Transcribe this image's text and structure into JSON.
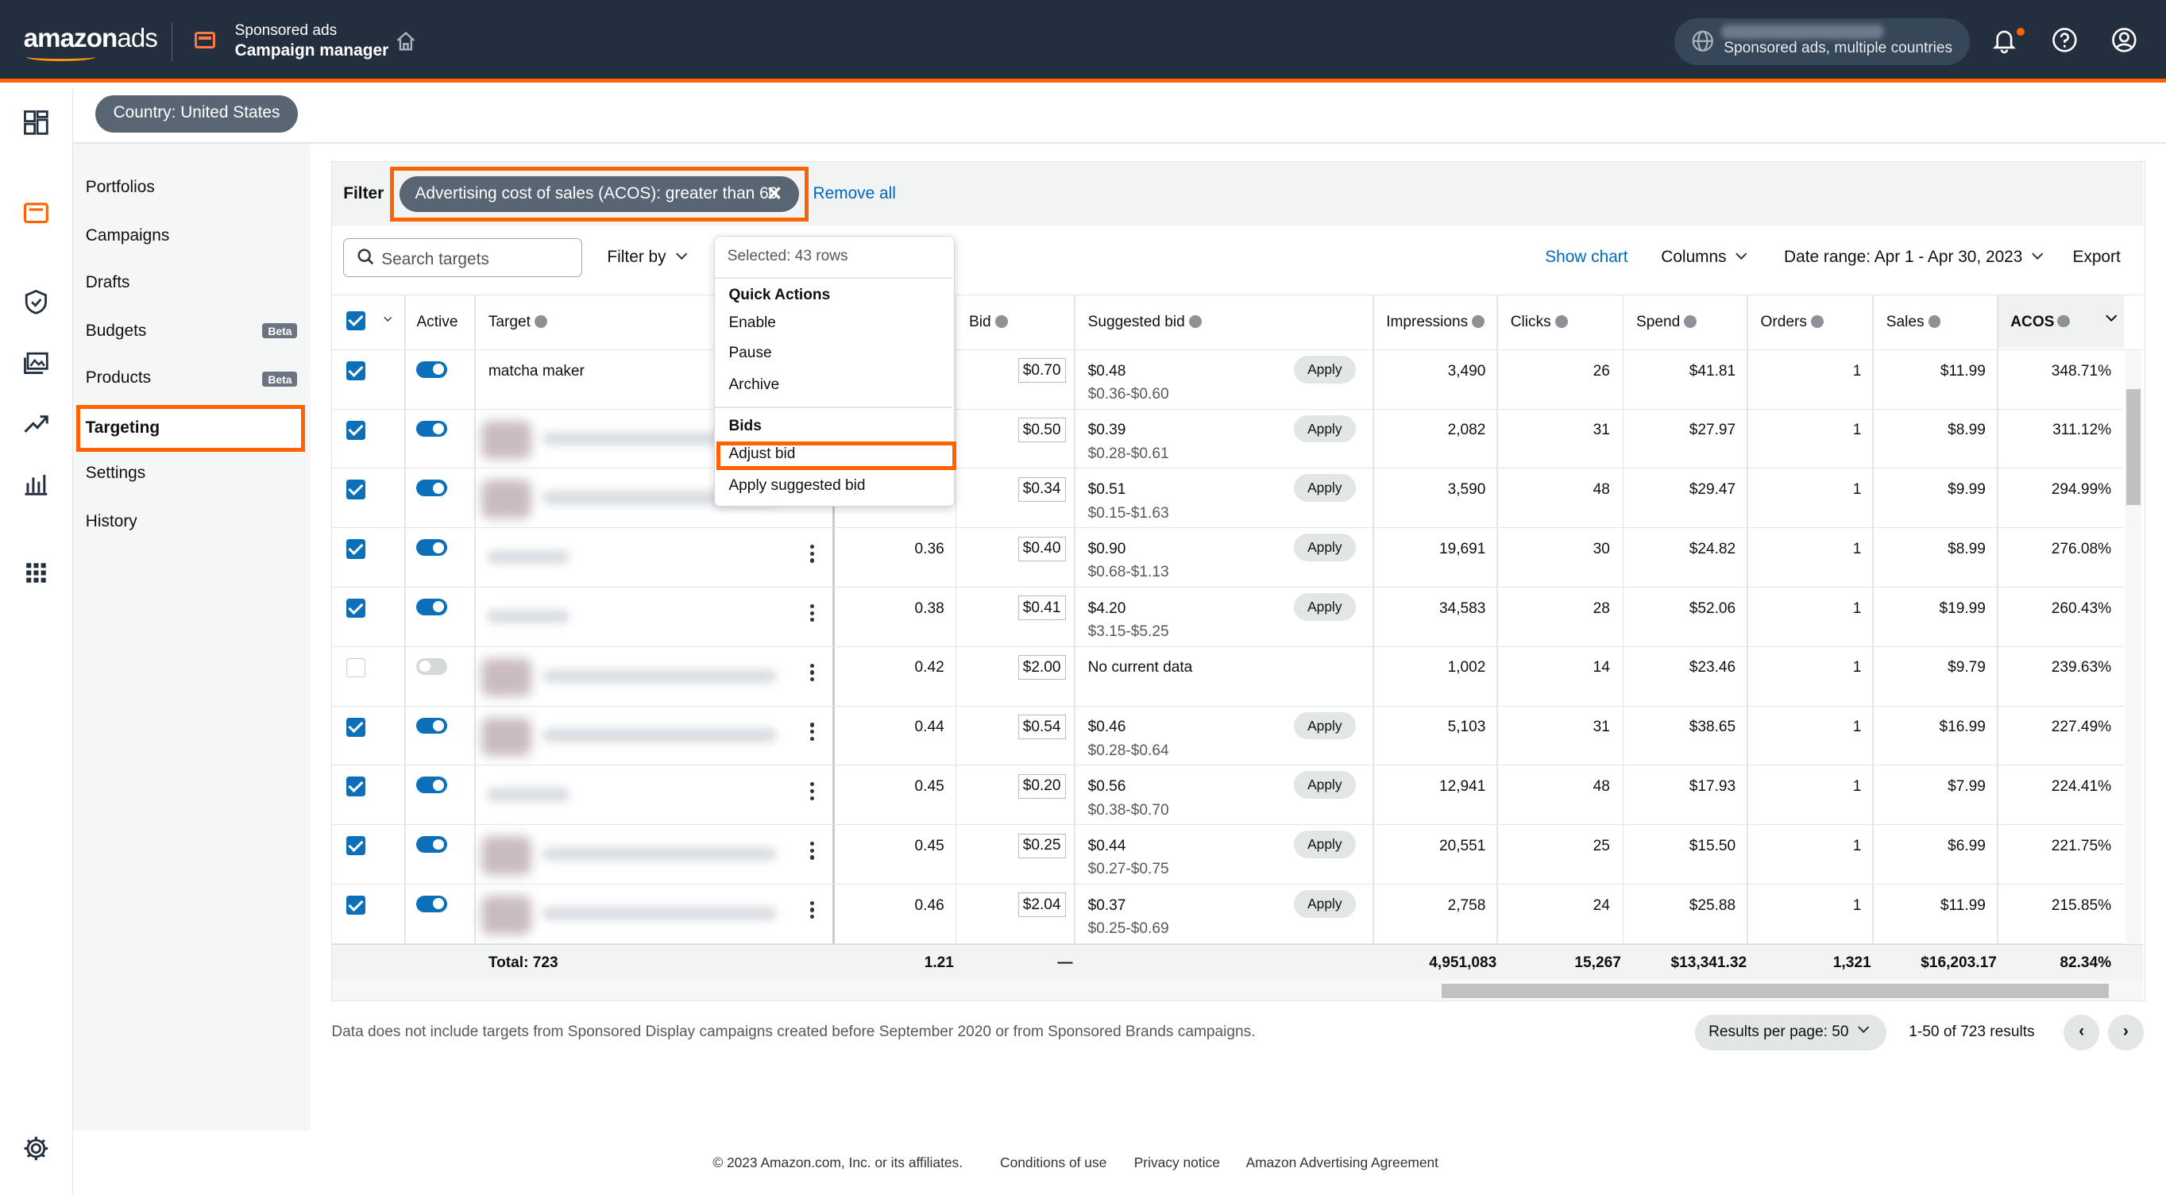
{
  "topbar": {
    "logo_text": "amazon",
    "logo_suffix": "ads",
    "product_line1": "Sponsored ads",
    "product_line2": "Campaign manager",
    "account_label": "Sponsored ads, multiple countries"
  },
  "country_pill": "Country: United States",
  "sidenav": {
    "items": [
      {
        "label": "Portfolios"
      },
      {
        "label": "Campaigns"
      },
      {
        "label": "Drafts"
      },
      {
        "label": "Budgets",
        "badge": "Beta"
      },
      {
        "label": "Products",
        "badge": "Beta"
      },
      {
        "label": "Targeting",
        "active": true
      },
      {
        "label": "Settings"
      },
      {
        "label": "History"
      }
    ]
  },
  "filterbar": {
    "label": "Filter",
    "chip": "Advertising cost of sales (ACOS): greater than 60",
    "chip_close": "✕",
    "remove_all": "Remove all"
  },
  "toolbar": {
    "search_placeholder": "Search targets",
    "filter_by": "Filter by",
    "show_chart": "Show chart",
    "columns": "Columns",
    "date_range": "Date range: Apr 1 - Apr 30, 2023",
    "export": "Export"
  },
  "table": {
    "headers": {
      "active": "Active",
      "target": "Target",
      "bid": "Bid",
      "suggested_bid": "Suggested bid",
      "impressions": "Impressions",
      "clicks": "Clicks",
      "spend": "Spend",
      "orders": "Orders",
      "sales": "Sales",
      "acos": "ACOS"
    },
    "rows": [
      {
        "checked": true,
        "active": true,
        "target": "matcha maker",
        "col": "",
        "bid": "$0.70",
        "suggested": "$0.48",
        "range": "$0.36-$0.60",
        "apply": "Apply",
        "impressions": "3,490",
        "clicks": "26",
        "spend": "$41.81",
        "orders": "1",
        "sales": "$11.99",
        "acos": "348.71%"
      },
      {
        "checked": true,
        "active": true,
        "target": "",
        "col": "",
        "bid": "$0.50",
        "suggested": "$0.39",
        "range": "$0.28-$0.61",
        "apply": "Apply",
        "impressions": "2,082",
        "clicks": "31",
        "spend": "$27.97",
        "orders": "1",
        "sales": "$8.99",
        "acos": "311.12%"
      },
      {
        "checked": true,
        "active": true,
        "target": "",
        "col": "",
        "bid": "$0.34",
        "suggested": "$0.51",
        "range": "$0.15-$1.63",
        "apply": "Apply",
        "impressions": "3,590",
        "clicks": "48",
        "spend": "$29.47",
        "orders": "1",
        "sales": "$9.99",
        "acos": "294.99%"
      },
      {
        "checked": true,
        "active": true,
        "target": "",
        "col": "0.36",
        "bid": "$0.40",
        "suggested": "$0.90",
        "range": "$0.68-$1.13",
        "apply": "Apply",
        "impressions": "19,691",
        "clicks": "30",
        "spend": "$24.82",
        "orders": "1",
        "sales": "$8.99",
        "acos": "276.08%"
      },
      {
        "checked": true,
        "active": true,
        "target": "",
        "col": "0.38",
        "bid": "$0.41",
        "suggested": "$4.20",
        "range": "$3.15-$5.25",
        "apply": "Apply",
        "impressions": "34,583",
        "clicks": "28",
        "spend": "$52.06",
        "orders": "1",
        "sales": "$19.99",
        "acos": "260.43%"
      },
      {
        "checked": false,
        "active": false,
        "target": "",
        "col": "0.42",
        "bid": "$2.00",
        "suggested": "No current data",
        "range": "",
        "apply": "",
        "impressions": "1,002",
        "clicks": "14",
        "spend": "$23.46",
        "orders": "1",
        "sales": "$9.79",
        "acos": "239.63%"
      },
      {
        "checked": true,
        "active": true,
        "target": "",
        "col": "0.44",
        "bid": "$0.54",
        "suggested": "$0.46",
        "range": "$0.28-$0.64",
        "apply": "Apply",
        "impressions": "5,103",
        "clicks": "31",
        "spend": "$38.65",
        "orders": "1",
        "sales": "$16.99",
        "acos": "227.49%"
      },
      {
        "checked": true,
        "active": true,
        "target": "",
        "col": "0.45",
        "bid": "$0.20",
        "suggested": "$0.56",
        "range": "$0.38-$0.70",
        "apply": "Apply",
        "impressions": "12,941",
        "clicks": "48",
        "spend": "$17.93",
        "orders": "1",
        "sales": "$7.99",
        "acos": "224.41%"
      },
      {
        "checked": true,
        "active": true,
        "target": "",
        "col": "0.45",
        "bid": "$0.25",
        "suggested": "$0.44",
        "range": "$0.27-$0.75",
        "apply": "Apply",
        "impressions": "20,551",
        "clicks": "25",
        "spend": "$15.50",
        "orders": "1",
        "sales": "$6.99",
        "acos": "221.75%"
      },
      {
        "checked": true,
        "active": true,
        "target": "",
        "col": "0.46",
        "bid": "$2.04",
        "suggested": "$0.37",
        "range": "$0.25-$0.69",
        "apply": "Apply",
        "impressions": "2,758",
        "clicks": "24",
        "spend": "$25.88",
        "orders": "1",
        "sales": "$11.99",
        "acos": "215.85%"
      }
    ],
    "totals": {
      "label": "Total: 723",
      "col": "1.21",
      "bid": "—",
      "impressions": "4,951,083",
      "clicks": "15,267",
      "spend": "$13,341.32",
      "orders": "1,321",
      "sales": "$16,203.17",
      "acos": "82.34%"
    }
  },
  "dropdown": {
    "selected": "Selected: 43 rows",
    "quick_actions_title": "Quick Actions",
    "quick_actions": [
      "Enable",
      "Pause",
      "Archive"
    ],
    "bids_title": "Bids",
    "bids": [
      "Adjust bid",
      "Apply suggested bid"
    ]
  },
  "footer": {
    "note": "Data does not include targets from Sponsored Display campaigns created before September 2020 or from Sponsored Brands campaigns.",
    "results_per_page": "Results per page: 50",
    "results": "1-50 of 723 results",
    "prev": "‹",
    "next": "›",
    "copyright": "© 2023 Amazon.com, Inc. or its affiliates.",
    "links": [
      "Conditions of use",
      "Privacy notice",
      "Amazon Advertising Agreement"
    ]
  },
  "colors": {
    "topbar": "#232f3e",
    "accent": "#ff6200",
    "checkbox": "#0b70b9",
    "link": "#0066c0"
  }
}
